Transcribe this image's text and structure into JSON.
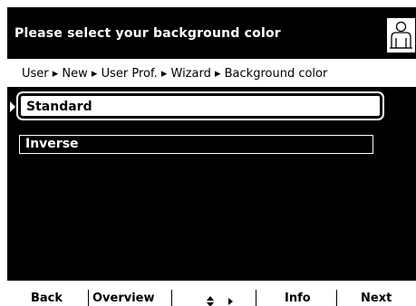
{
  "header": {
    "title": "Please select your background color",
    "icon": "user-icon"
  },
  "breadcrumb": {
    "text": "User ▸ New ▸ User Prof. ▸ Wizard ▸ Background color"
  },
  "options": [
    {
      "label": "Standard",
      "selected": true
    },
    {
      "label": "Inverse",
      "selected": false
    }
  ],
  "softkeys": {
    "back": "Back",
    "overview": "Overview",
    "navigate_icon": "up-down-right-arrows-icon",
    "info": "Info",
    "next": "Next"
  }
}
